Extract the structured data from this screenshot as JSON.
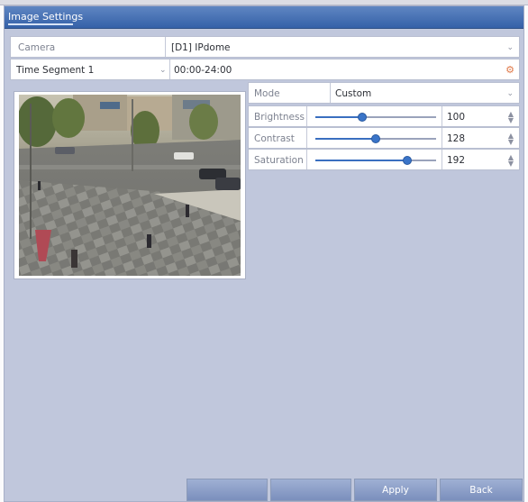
{
  "window": {
    "tab_title": "Image Settings"
  },
  "camera": {
    "label": "Camera",
    "value": "[D1] IPdome"
  },
  "time_segment": {
    "label": "Time Segment 1",
    "value": "00:00-24:00"
  },
  "mode": {
    "label": "Mode",
    "value": "Custom"
  },
  "params": [
    {
      "label": "Brightness",
      "value": "100",
      "level": 0.39
    },
    {
      "label": "Contrast",
      "value": "128",
      "level": 0.5
    },
    {
      "label": "Saturation",
      "value": "192",
      "level": 0.76
    }
  ],
  "buttons": {
    "b1": "",
    "b2": "",
    "apply": "Apply",
    "back": "Back"
  },
  "colors": {
    "titlebar": "#3561a8",
    "panel": "#c0c7dc",
    "slider": "#3a74c8"
  }
}
